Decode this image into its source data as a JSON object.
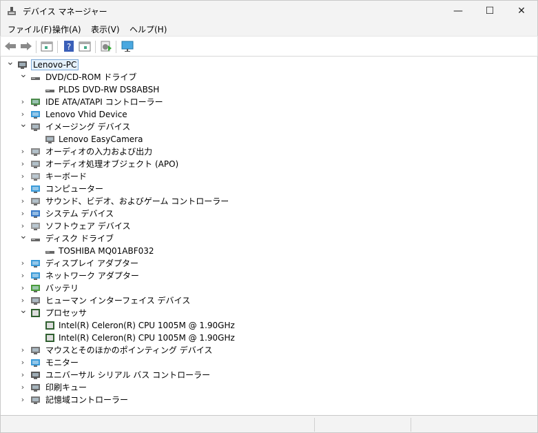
{
  "window": {
    "title": "デバイス マネージャー",
    "minimize": "—",
    "maximize": "☐",
    "close": "✕"
  },
  "menu": [
    "ファイル(F)",
    "操作(A)",
    "表示(V)",
    "ヘルプ(H)"
  ],
  "toolbar": [
    "back-icon",
    "forward-icon",
    "properties-icon",
    "help-icon",
    "view-icon",
    "scan-hardware-icon",
    "monitor-icon"
  ],
  "tree": [
    {
      "label": "Lenovo-PC",
      "level": 0,
      "state": "expanded",
      "icon": "computer-root-icon",
      "selected": true
    },
    {
      "label": "DVD/CD-ROM ドライブ",
      "level": 1,
      "state": "expanded",
      "icon": "dvd-drive-icon"
    },
    {
      "label": "PLDS DVD-RW DS8ABSH",
      "level": 2,
      "state": "leaf",
      "icon": "dvd-drive-icon"
    },
    {
      "label": "IDE ATA/ATAPI コントローラー",
      "level": 1,
      "state": "collapsed",
      "icon": "ide-controller-icon"
    },
    {
      "label": "Lenovo Vhid Device",
      "level": 1,
      "state": "collapsed",
      "icon": "monitor-device-icon"
    },
    {
      "label": "イメージング デバイス",
      "level": 1,
      "state": "expanded",
      "icon": "camera-icon"
    },
    {
      "label": "Lenovo EasyCamera",
      "level": 2,
      "state": "leaf",
      "icon": "camera-icon"
    },
    {
      "label": "オーディオの入力および出力",
      "level": 1,
      "state": "collapsed",
      "icon": "speaker-icon"
    },
    {
      "label": "オーディオ処理オブジェクト (APO)",
      "level": 1,
      "state": "collapsed",
      "icon": "speaker-icon"
    },
    {
      "label": "キーボード",
      "level": 1,
      "state": "collapsed",
      "icon": "keyboard-icon"
    },
    {
      "label": "コンピューター",
      "level": 1,
      "state": "collapsed",
      "icon": "computer-icon"
    },
    {
      "label": "サウンド、ビデオ、およびゲーム コントローラー",
      "level": 1,
      "state": "collapsed",
      "icon": "speaker-icon"
    },
    {
      "label": "システム デバイス",
      "level": 1,
      "state": "collapsed",
      "icon": "system-device-icon"
    },
    {
      "label": "ソフトウェア デバイス",
      "level": 1,
      "state": "collapsed",
      "icon": "software-device-icon"
    },
    {
      "label": "ディスク ドライブ",
      "level": 1,
      "state": "expanded",
      "icon": "disk-drive-icon"
    },
    {
      "label": "TOSHIBA MQ01ABF032",
      "level": 2,
      "state": "leaf",
      "icon": "disk-drive-icon"
    },
    {
      "label": "ディスプレイ アダプター",
      "level": 1,
      "state": "collapsed",
      "icon": "display-adapter-icon"
    },
    {
      "label": "ネットワーク アダプター",
      "level": 1,
      "state": "collapsed",
      "icon": "network-adapter-icon"
    },
    {
      "label": "バッテリ",
      "level": 1,
      "state": "collapsed",
      "icon": "battery-icon"
    },
    {
      "label": "ヒューマン インターフェイス デバイス",
      "level": 1,
      "state": "collapsed",
      "icon": "hid-icon"
    },
    {
      "label": "プロセッサ",
      "level": 1,
      "state": "expanded",
      "icon": "processor-icon"
    },
    {
      "label": "Intel(R) Celeron(R) CPU 1005M @ 1.90GHz",
      "level": 2,
      "state": "leaf",
      "icon": "processor-icon"
    },
    {
      "label": "Intel(R) Celeron(R) CPU 1005M @ 1.90GHz",
      "level": 2,
      "state": "leaf",
      "icon": "processor-icon"
    },
    {
      "label": "マウスとそのほかのポインティング デバイス",
      "level": 1,
      "state": "collapsed",
      "icon": "mouse-icon"
    },
    {
      "label": "モニター",
      "level": 1,
      "state": "collapsed",
      "icon": "monitor-icon"
    },
    {
      "label": "ユニバーサル シリアル バス コントローラー",
      "level": 1,
      "state": "collapsed",
      "icon": "usb-icon"
    },
    {
      "label": "印刷キュー",
      "level": 1,
      "state": "collapsed",
      "icon": "printer-icon"
    },
    {
      "label": "記憶域コントローラー",
      "level": 1,
      "state": "collapsed",
      "icon": "storage-controller-icon"
    }
  ]
}
